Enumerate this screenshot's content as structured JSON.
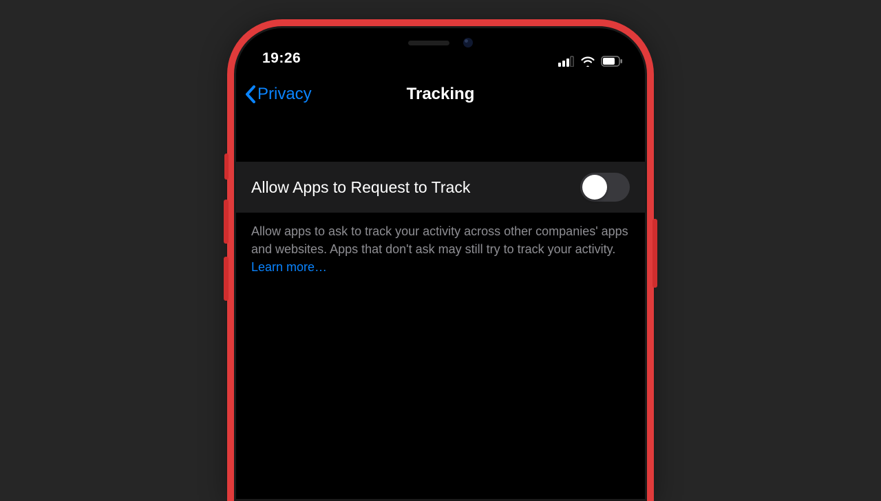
{
  "status": {
    "time": "19:26"
  },
  "nav": {
    "back_label": "Privacy",
    "title": "Tracking"
  },
  "setting": {
    "label": "Allow Apps to Request to Track",
    "enabled": false
  },
  "footer": {
    "text": "Allow apps to ask to track your activity across other companies' apps and websites. Apps that don't ask may still try to track your activity. ",
    "learn_more": "Learn more…"
  },
  "colors": {
    "accent": "#0a84ff",
    "frame": "#e03b3b",
    "background": "#262626"
  }
}
